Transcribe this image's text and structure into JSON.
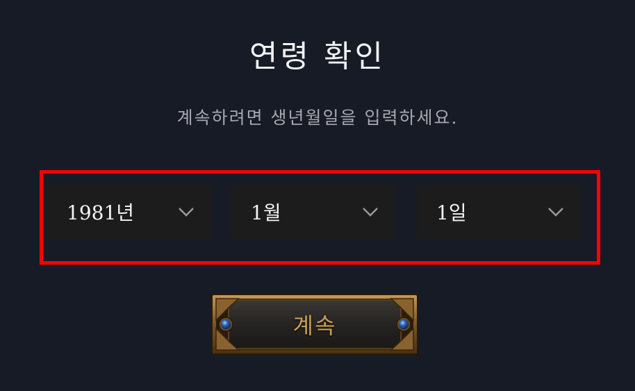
{
  "header": {
    "title": "연령 확인",
    "subtitle": "계속하려면 생년월일을 입력하세요."
  },
  "birthdate": {
    "year": {
      "value": "1981년",
      "icon": "chevron-down-icon"
    },
    "month": {
      "value": "1월",
      "icon": "chevron-down-icon"
    },
    "day": {
      "value": "1일",
      "icon": "chevron-down-icon"
    }
  },
  "actions": {
    "continue_label": "계속"
  },
  "colors": {
    "background": "#161b26",
    "select_bg": "#1c1c1c",
    "highlight": "#ff0000",
    "button_text": "#c9a055"
  }
}
